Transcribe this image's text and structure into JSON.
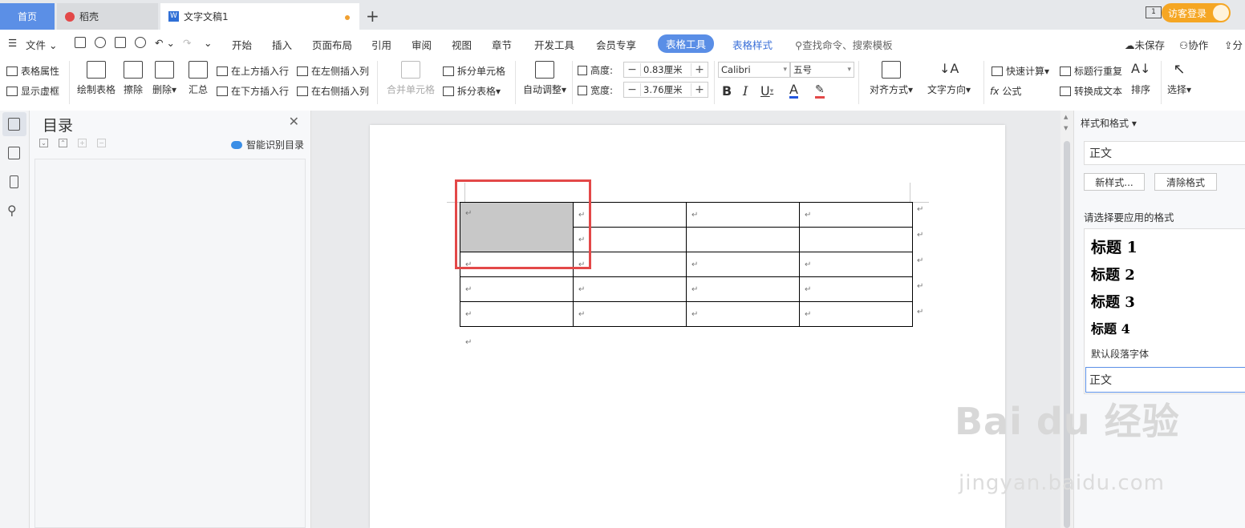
{
  "tabs": {
    "home": "首页",
    "daoke": "稻壳",
    "document": "文字文稿1",
    "guest_login": "访客登录"
  },
  "menu": {
    "file": "文件",
    "items": [
      "开始",
      "插入",
      "页面布局",
      "引用",
      "审阅",
      "视图",
      "章节",
      "开发工具",
      "会员专享"
    ],
    "table_tools": "表格工具",
    "table_style": "表格样式",
    "search_placeholder": "查找命令、搜索模板",
    "unsaved": "未保存",
    "collab": "协作",
    "share": "分"
  },
  "ribbon": {
    "table_props": "表格属性",
    "show_gridlines": "显示虚框",
    "draw_table": "绘制表格",
    "erase": "擦除",
    "delete": "删除",
    "summary": "汇总",
    "insert_above": "在上方插入行",
    "insert_below": "在下方插入行",
    "insert_left": "在左侧插入列",
    "insert_right": "在右侧插入列",
    "merge_cells": "合并单元格",
    "split_cells": "拆分单元格",
    "split_table": "拆分表格",
    "auto_fit": "自动调整",
    "height_label": "高度:",
    "height_value": "0.83厘米",
    "width_label": "宽度:",
    "width_value": "3.76厘米",
    "font_name": "Calibri",
    "font_size": "五号",
    "bold": "B",
    "italic": "I",
    "underline": "U",
    "font_color": "A",
    "align": "对齐方式",
    "text_direction": "文字方向",
    "quick_calc": "快速计算",
    "formula": "公式",
    "repeat_header": "标题行重复",
    "to_text": "转换成文本",
    "sort": "排序",
    "select": "选择"
  },
  "toc": {
    "title": "目录",
    "smart_recognize": "智能识别目录"
  },
  "styles_panel": {
    "header": "样式和格式",
    "current_style": "正文",
    "new_style": "新样式...",
    "clear_format": "清除格式",
    "apply_prompt": "请选择要应用的格式",
    "styles": [
      "标题 1",
      "标题 2",
      "标题 3",
      "标题 4"
    ],
    "default_font": "默认段落字体",
    "selected": "正文"
  },
  "document": {
    "return_mark": "↵",
    "table": {
      "rows": 5,
      "cols": 4,
      "shaded_cell": "merged top-left (2 rows)"
    }
  },
  "watermark": {
    "brand": "Bai du 经验",
    "url": "jingyan.baidu.com"
  },
  "colors": {
    "accent": "#5b8fe6",
    "highlight_box": "#e34848",
    "shaded_cell": "#c8c8c8",
    "guest_button": "#f5a623"
  }
}
